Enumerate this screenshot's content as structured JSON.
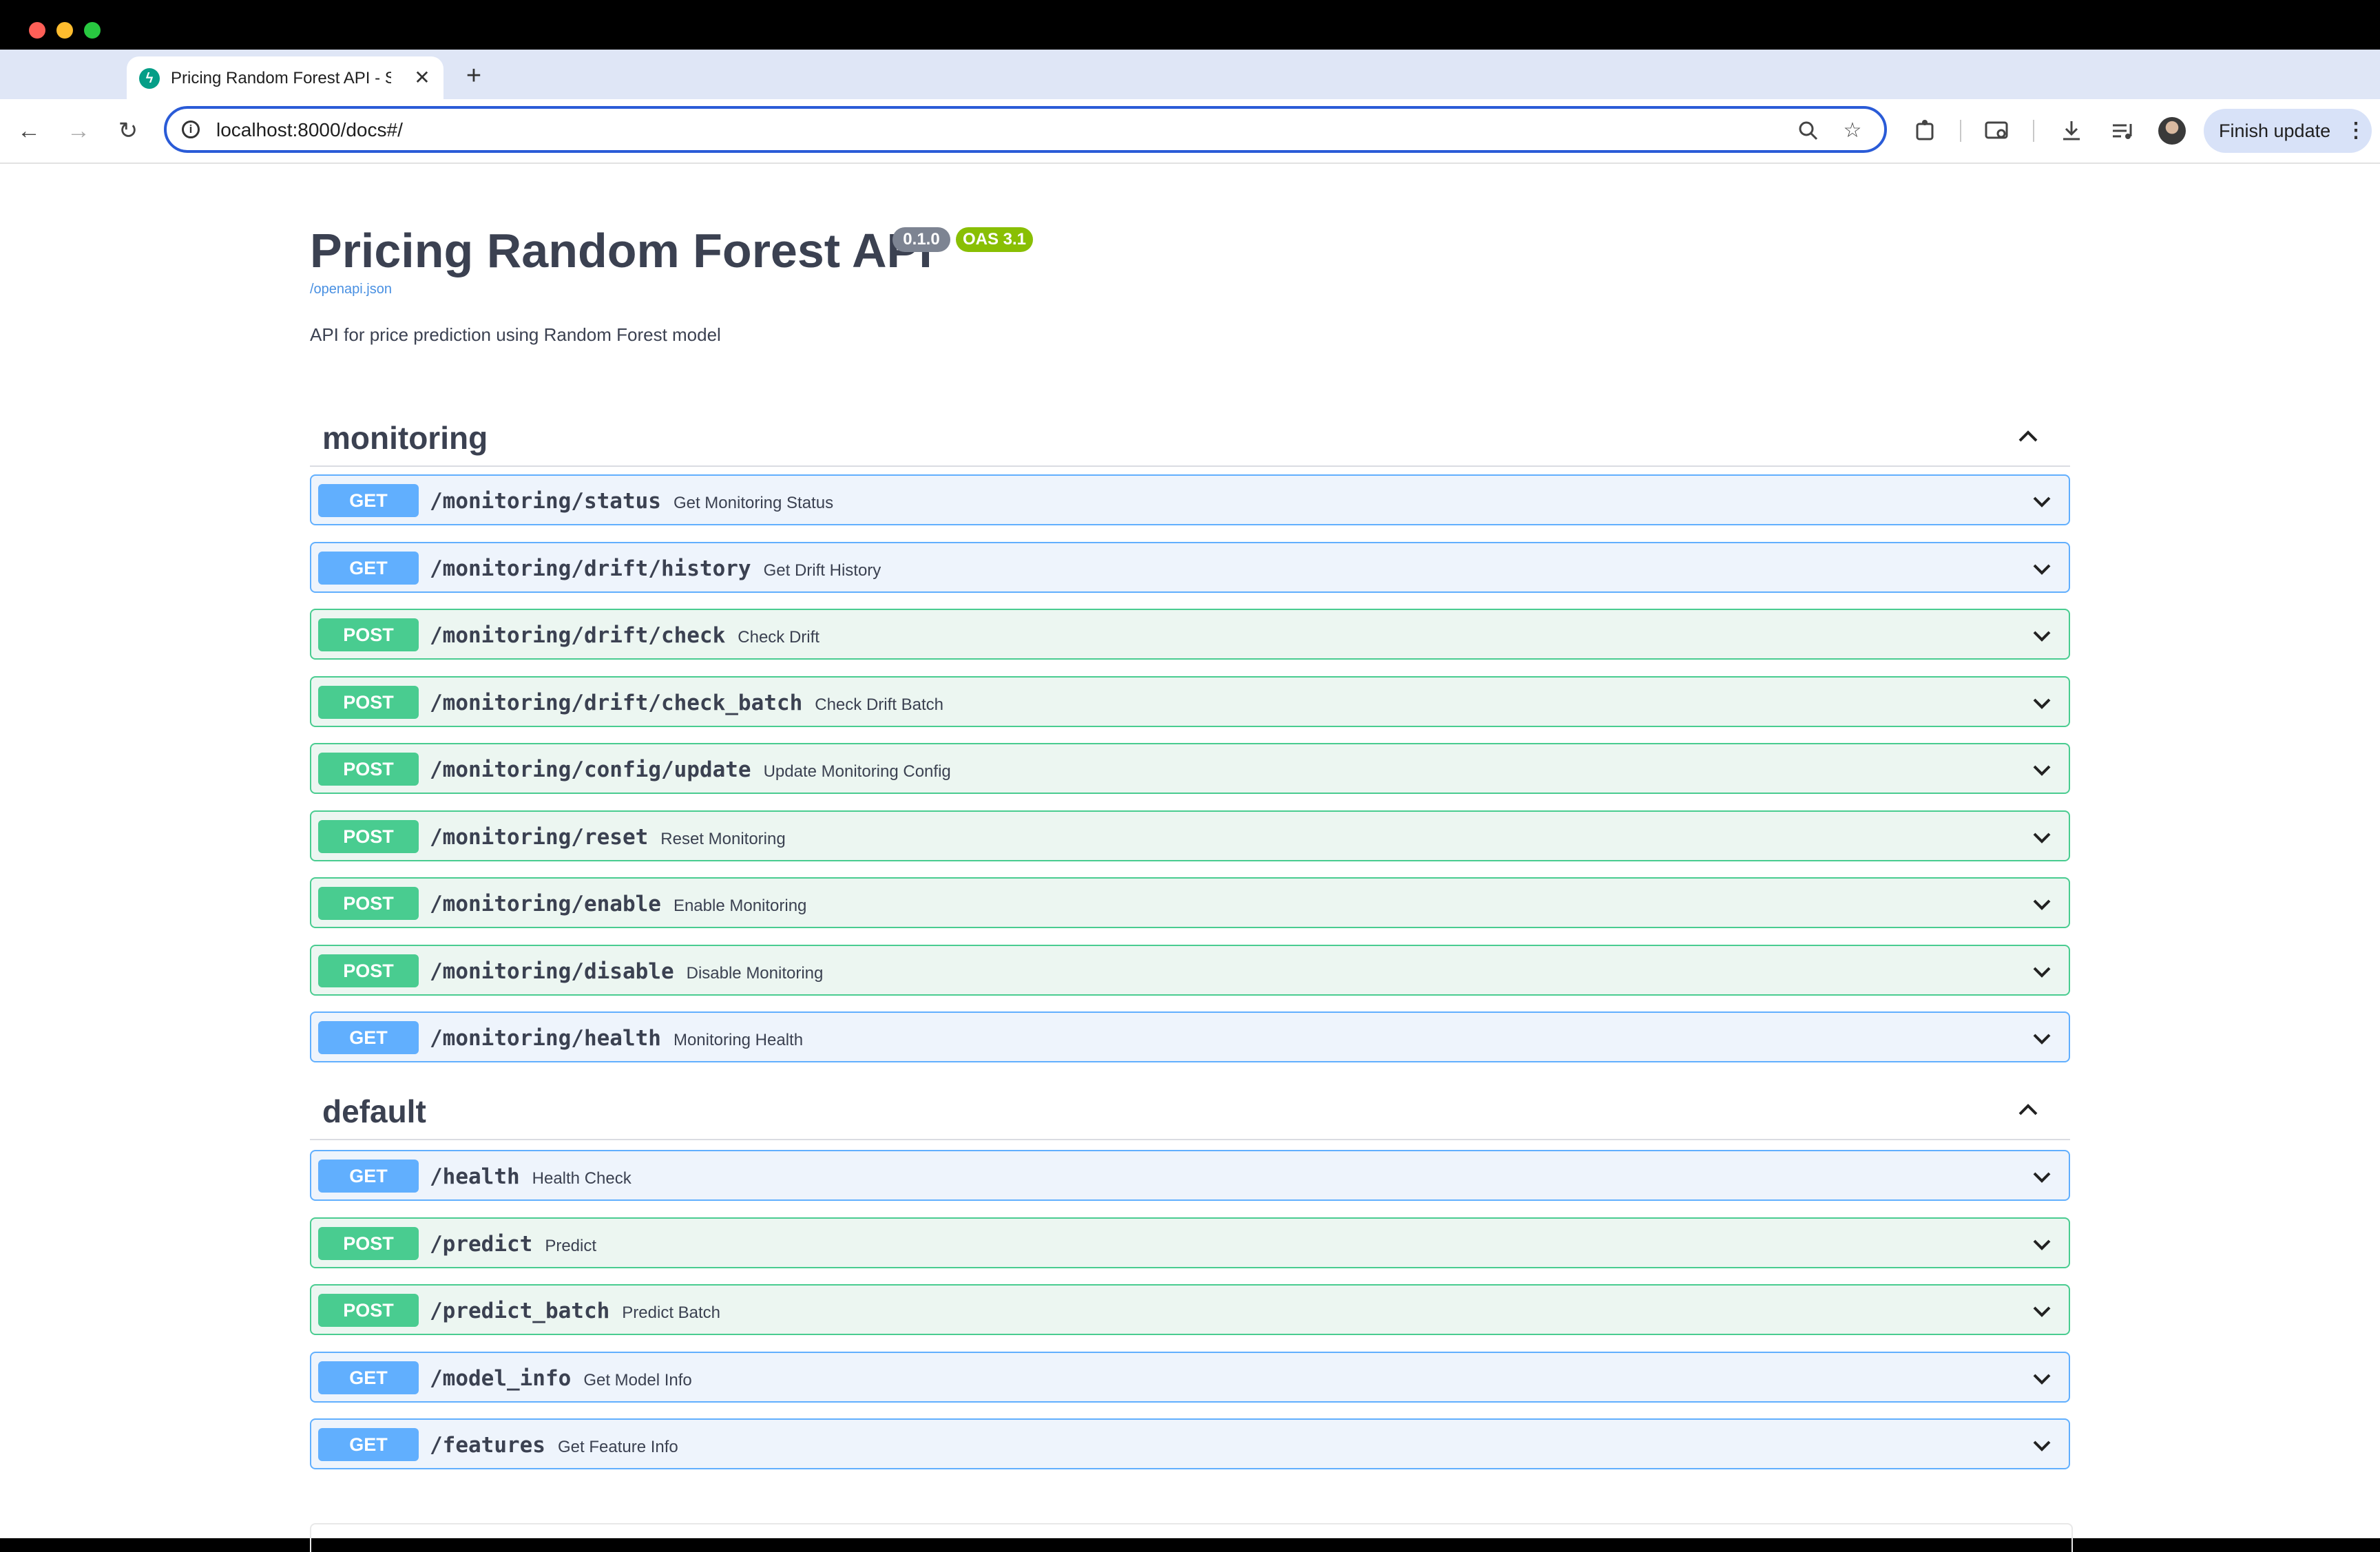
{
  "browser": {
    "tab_title": "Pricing Random Forest API - S",
    "tab_close": "✕",
    "new_tab": "+",
    "url": "localhost:8000/docs#/",
    "finish_update": "Finish update"
  },
  "api": {
    "title": "Pricing Random Forest API",
    "version": "0.1.0",
    "oas": "OAS 3.1",
    "spec_link": "/openapi.json",
    "description": "API for price prediction using Random Forest model"
  },
  "sections": {
    "monitoring": {
      "title": "monitoring",
      "operations": [
        {
          "method": "GET",
          "path": "/monitoring/status",
          "summary": "Get Monitoring Status"
        },
        {
          "method": "GET",
          "path": "/monitoring/drift/history",
          "summary": "Get Drift History"
        },
        {
          "method": "POST",
          "path": "/monitoring/drift/check",
          "summary": "Check Drift"
        },
        {
          "method": "POST",
          "path": "/monitoring/drift/check_batch",
          "summary": "Check Drift Batch"
        },
        {
          "method": "POST",
          "path": "/monitoring/config/update",
          "summary": "Update Monitoring Config"
        },
        {
          "method": "POST",
          "path": "/monitoring/reset",
          "summary": "Reset Monitoring"
        },
        {
          "method": "POST",
          "path": "/monitoring/enable",
          "summary": "Enable Monitoring"
        },
        {
          "method": "POST",
          "path": "/monitoring/disable",
          "summary": "Disable Monitoring"
        },
        {
          "method": "GET",
          "path": "/monitoring/health",
          "summary": "Monitoring Health"
        }
      ]
    },
    "default": {
      "title": "default",
      "operations": [
        {
          "method": "GET",
          "path": "/health",
          "summary": "Health Check"
        },
        {
          "method": "POST",
          "path": "/predict",
          "summary": "Predict"
        },
        {
          "method": "POST",
          "path": "/predict_batch",
          "summary": "Predict Batch"
        },
        {
          "method": "GET",
          "path": "/model_info",
          "summary": "Get Model Info"
        },
        {
          "method": "GET",
          "path": "/features",
          "summary": "Get Feature Info"
        }
      ]
    }
  }
}
